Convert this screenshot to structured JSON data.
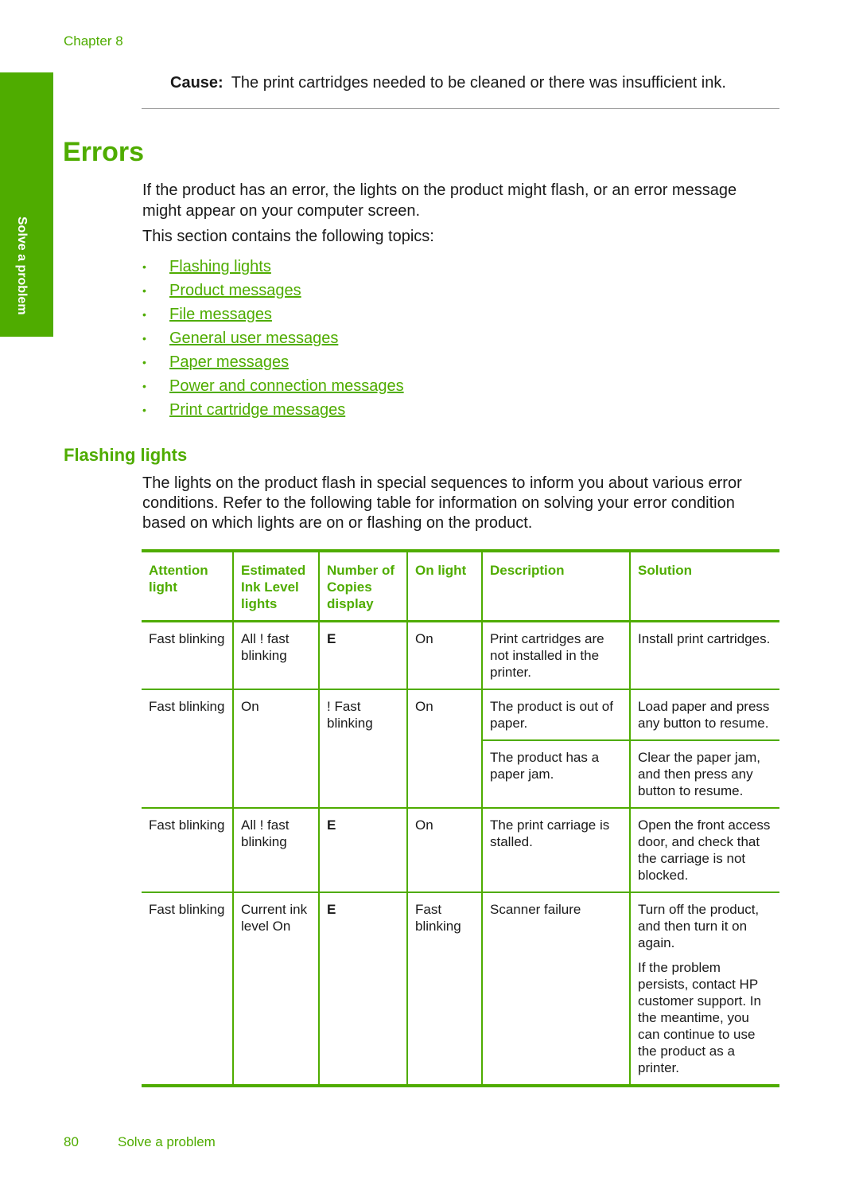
{
  "header": {
    "chapter": "Chapter 8"
  },
  "side_tab": {
    "label": "Solve a problem"
  },
  "cause": {
    "label": "Cause:",
    "text": "The print cartridges needed to be cleaned or there was insufficient ink."
  },
  "errors": {
    "title": "Errors",
    "intro": "If the product has an error, the lights on the product might flash, or an error message might appear on your computer screen.",
    "topics_intro": "This section contains the following topics:",
    "topics": [
      "Flashing lights",
      "Product messages",
      "File messages",
      "General user messages",
      "Paper messages",
      "Power and connection messages",
      "Print cartridge messages"
    ]
  },
  "flashing": {
    "title": "Flashing lights",
    "para": "The lights on the product flash in special sequences to inform you about various error conditions. Refer to the following table for information on solving your error condition based on which lights are on or flashing on the product.",
    "table": {
      "headers": [
        "Attention light",
        "Estimated Ink Level lights",
        "Number of Copies display",
        "On light",
        "Description",
        "Solution"
      ],
      "rows": [
        {
          "attention": "Fast blinking",
          "ink": "All ! fast blinking",
          "copies": "E",
          "on": "On",
          "description": "Print cartridges are not installed in the printer.",
          "solution": "Install print cartridges."
        },
        {
          "attention": "Fast blinking",
          "ink": "On",
          "copies": "! Fast blinking",
          "on": "On",
          "description": "The product is out of paper.",
          "solution": "Load paper and press any button to resume.",
          "description2": "The product has a paper jam.",
          "solution2": "Clear the paper jam, and then press any button to resume."
        },
        {
          "attention": "Fast blinking",
          "ink": "All ! fast blinking",
          "copies": "E",
          "on": "On",
          "description": "The print carriage is stalled.",
          "solution": "Open the front access door, and check that the carriage is not blocked."
        },
        {
          "attention": "Fast blinking",
          "ink": "Current ink level On",
          "copies": "E",
          "on": "Fast blinking",
          "description": "Scanner failure",
          "solution": "Turn off the product, and then turn it on again.",
          "solution_extra": "If the problem persists, contact HP customer support. In the meantime, you can continue to use the product as a printer."
        }
      ]
    }
  },
  "footer": {
    "page_number": "80",
    "section": "Solve a problem"
  }
}
